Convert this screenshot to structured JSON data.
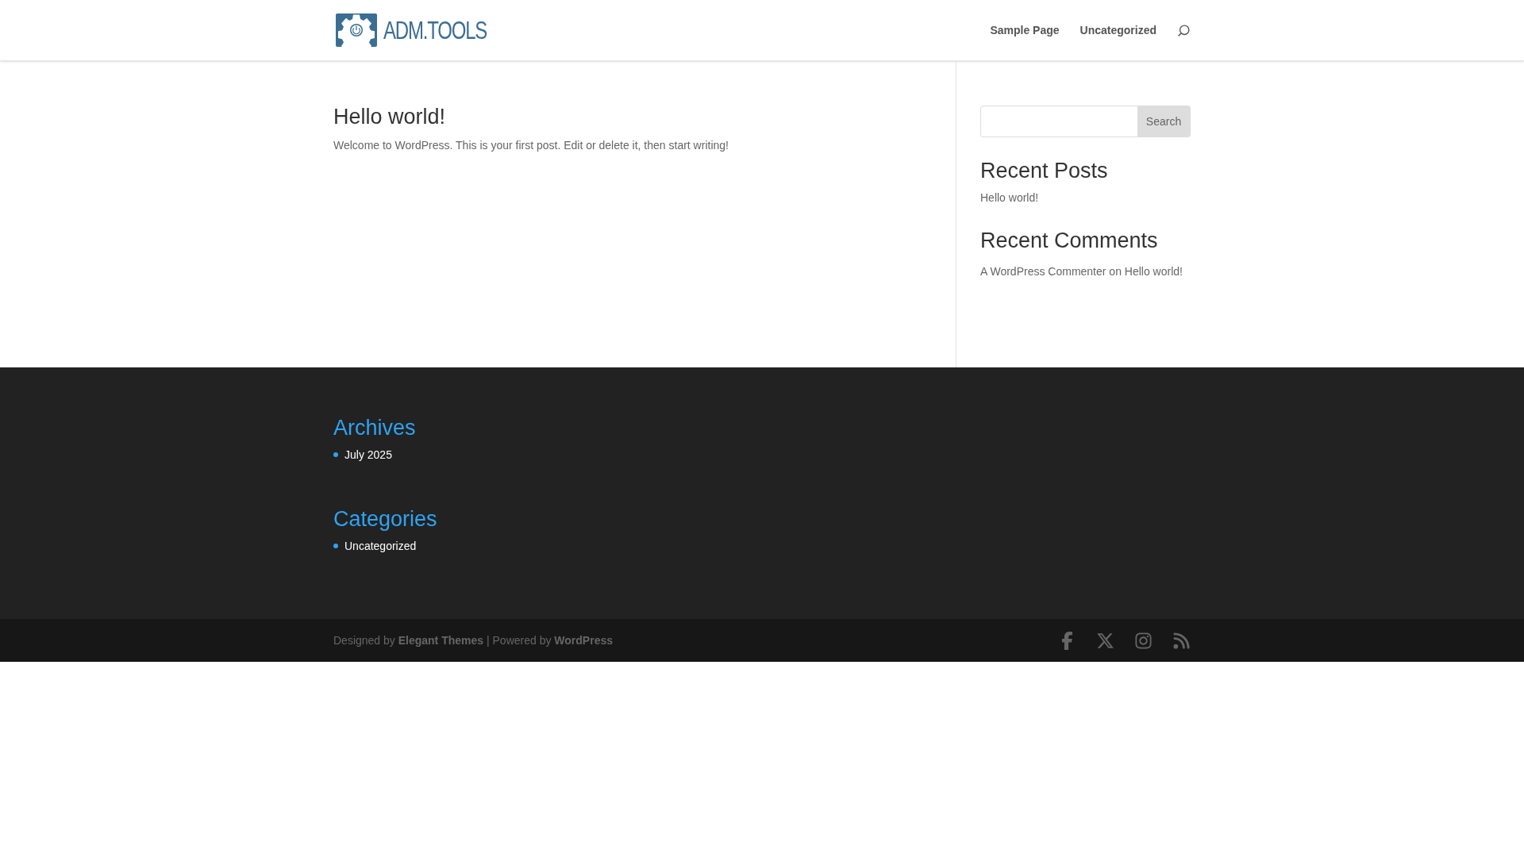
{
  "header": {
    "logo_text": "ADM.TOOLS",
    "nav": [
      {
        "label": "Sample Page"
      },
      {
        "label": "Uncategorized"
      }
    ]
  },
  "post": {
    "title": "Hello world!",
    "excerpt": "Welcome to WordPress. This is your first post. Edit or delete it, then start writing!"
  },
  "sidebar": {
    "search_button": "Search",
    "recent_posts": {
      "title": "Recent Posts",
      "items": [
        "Hello world!"
      ]
    },
    "recent_comments": {
      "title": "Recent Comments",
      "author": "A WordPress Commenter",
      "connector": "on",
      "post": "Hello world!"
    }
  },
  "footer_widgets": [
    {
      "title": "Archives",
      "items": [
        "July 2025"
      ]
    },
    {
      "title": "Categories",
      "items": [
        "Uncategorized"
      ]
    }
  ],
  "footer_bottom": {
    "designed_by": "Designed by",
    "theme_link": "Elegant Themes",
    "powered_by": "| Powered by",
    "platform_link": "WordPress",
    "social": [
      {
        "kind": "facebook"
      },
      {
        "kind": "x"
      },
      {
        "kind": "instagram"
      },
      {
        "kind": "rss"
      }
    ]
  }
}
